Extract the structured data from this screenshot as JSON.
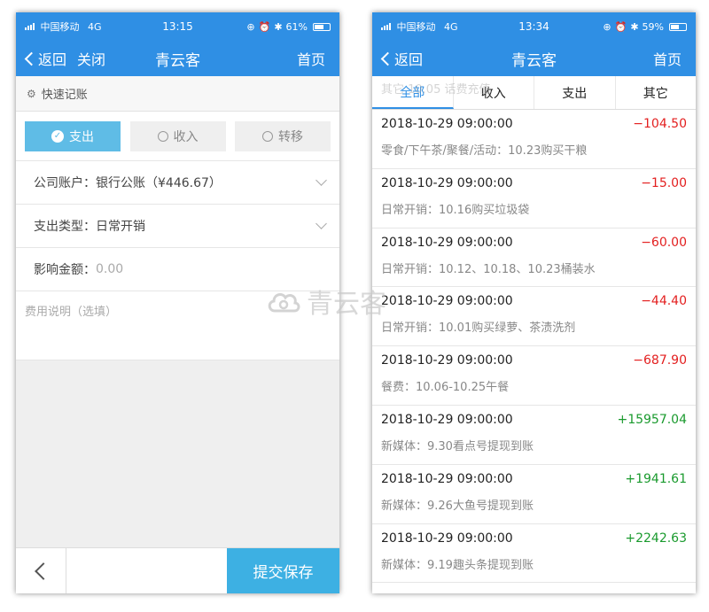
{
  "left": {
    "status": {
      "carrier": "中国移动",
      "network": "4G",
      "time": "13:15",
      "battery": "61%",
      "battery_level": 0.61
    },
    "nav": {
      "back": "返回",
      "close": "关闭",
      "title": "青云客",
      "home": "首页"
    },
    "section": {
      "title": "快速记账"
    },
    "types": {
      "expense": "支出",
      "income": "收入",
      "transfer": "转移",
      "selected": "支出"
    },
    "form": {
      "account_label": "公司账户：",
      "account_value": "银行公账（¥446.67）",
      "category_label": "支出类型：",
      "category_value": "日常开销",
      "amount_label": "影响金额：",
      "amount_placeholder": "0.00",
      "note_placeholder": "费用说明（选填）"
    },
    "bottom": {
      "submit": "提交保存"
    }
  },
  "right": {
    "status": {
      "carrier": "中国移动",
      "network": "4G",
      "time": "13:34",
      "battery": "59%",
      "battery_level": 0.59
    },
    "nav": {
      "back": "返回",
      "title": "青云客",
      "home": "首页"
    },
    "tabs": [
      "全部",
      "收入",
      "支出",
      "其它"
    ],
    "active_tab": "全部",
    "ghost_text": "其它 10.05 话费充值",
    "records": [
      {
        "datetime": "2018-10-29 09:00:00",
        "amount": "−104.50",
        "type": "neg",
        "desc": "零食/下午茶/聚餐/活动：10.23购买干粮"
      },
      {
        "datetime": "2018-10-29 09:00:00",
        "amount": "−15.00",
        "type": "neg",
        "desc": "日常开销：10.16购买垃圾袋"
      },
      {
        "datetime": "2018-10-29 09:00:00",
        "amount": "−60.00",
        "type": "neg",
        "desc": "日常开销：10.12、10.18、10.23桶装水"
      },
      {
        "datetime": "2018-10-29 09:00:00",
        "amount": "−44.40",
        "type": "neg",
        "desc": "日常开销：10.01购买绿萝、茶渍洗剂"
      },
      {
        "datetime": "2018-10-29 09:00:00",
        "amount": "−687.90",
        "type": "neg",
        "desc": "餐费：10.06-10.25午餐"
      },
      {
        "datetime": "2018-10-29 09:00:00",
        "amount": "+15957.04",
        "type": "pos",
        "desc": "新媒体：9.30看点号提现到账"
      },
      {
        "datetime": "2018-10-29 09:00:00",
        "amount": "+1941.61",
        "type": "pos",
        "desc": "新媒体：9.26大鱼号提现到账"
      },
      {
        "datetime": "2018-10-29 09:00:00",
        "amount": "+2242.63",
        "type": "pos",
        "desc": "新媒体：9.19趣头条提现到账"
      }
    ]
  },
  "watermark": {
    "text": "青云客"
  },
  "colors": {
    "primary": "#2f8fe4",
    "active_button": "#5fbce6",
    "submit": "#3db0e3",
    "negative": "#e31f1f",
    "positive": "#1a9a2e"
  }
}
